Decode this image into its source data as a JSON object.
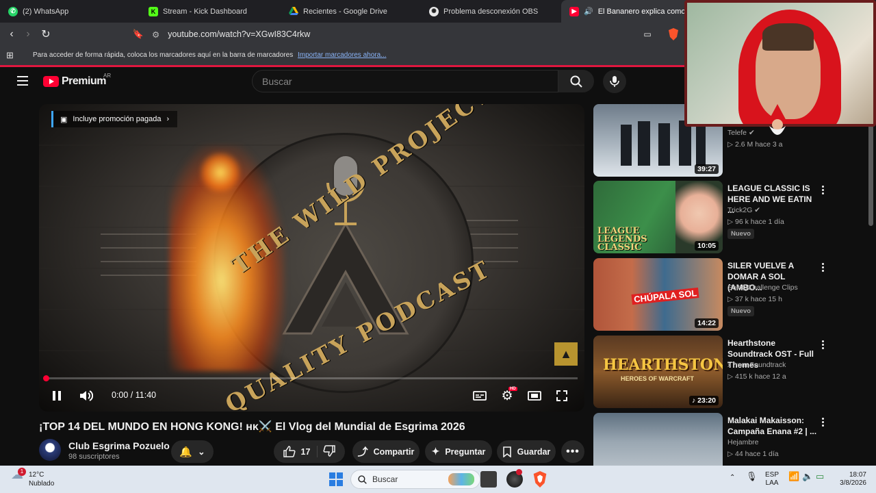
{
  "browser": {
    "tabs": [
      {
        "label": "(2) WhatsApp",
        "icon": "whatsapp-icon",
        "color": "#25d366"
      },
      {
        "label": "Stream - Kick Dashboard",
        "icon": "kick-icon",
        "color": "#53fc18"
      },
      {
        "label": "Recientes - Google Drive",
        "icon": "google-drive-icon",
        "color": "#fbbc04"
      },
      {
        "label": "Problema desconexión OBS",
        "icon": "chatgpt-icon",
        "color": "#cccccc"
      },
      {
        "label": "El Bananero explica como su",
        "icon": "youtube-icon",
        "color": "#ff0033"
      }
    ],
    "url": "youtube.com/watch?v=XGwI83C4rkw",
    "bookmarks_text": "Para acceder de forma rápida, coloca los marcadores aquí en la barra de marcadores",
    "bookmarks_link": "Importar marcadores ahora..."
  },
  "youtube": {
    "logo_text": "Premium",
    "region": "AR",
    "search_placeholder": "Buscar"
  },
  "player": {
    "promo_label": "Incluye promoción pagada",
    "time": "0:00 / 11:40",
    "progress": 0.0,
    "overlay_words": [
      "THE WILD PROJECT",
      "QUALITY PODCAST"
    ],
    "hd_badge": "HD"
  },
  "video": {
    "title": "¡TOP 14 DEL MUNDO EN HONG KONG! ʜᴋ⚔️ El Vlog del Mundial de Esgrima 2026",
    "channel": "Club Esgrima Pozuelo",
    "subscribers": "98 suscriptores",
    "likes": "17",
    "share_label": "Compartir",
    "ask_label": "Preguntar",
    "save_label": "Guardar"
  },
  "recommendations": [
    {
      "title": "",
      "channel": "Telefe",
      "verified": true,
      "views": "2.6 M",
      "age": "hace 3 a",
      "duration": "39:27",
      "new": false
    },
    {
      "title": "LEAGUE CLASSIC IS HERE AND WE EATIN ...",
      "channel": "Trick2G",
      "verified": true,
      "views": "96 k",
      "age": "hace 1 día",
      "duration": "10:05",
      "new": true
    },
    {
      "title": "SILER VUELVE A DOMAR A SOL (AMBO...",
      "channel": "SoloQChallenge Clips",
      "verified": false,
      "views": "37 k",
      "age": "hace 15 h",
      "duration": "14:22",
      "new": true
    },
    {
      "title": "Hearthstone Soundtrack OST - Full Themes",
      "channel": "xTrem Soundtrack",
      "verified": false,
      "views": "415 k",
      "age": "hace 12 a",
      "duration": "23:20",
      "new": false
    },
    {
      "title": "Malakai Makaisson: Campaña Enana #2 | ...",
      "channel": "Hejambre",
      "verified": false,
      "views": "44",
      "age": "hace 1 día",
      "duration": "",
      "new": false
    }
  ],
  "badge_new_label": "Nuevo",
  "thumb_texts": {
    "lol": "LEAGUE LEGENDS CLASSIC",
    "sol": "CHÚPALA SOL",
    "hs": "HEARTHSTONE",
    "hs_sub": "HEROES OF WARCRAFT"
  },
  "taskbar": {
    "temperature": "12°C",
    "weather": "Nublado",
    "weather_badge": "1",
    "search": "Buscar",
    "lang_top": "ESP",
    "lang_bottom": "LAA",
    "time": "18:07",
    "date": "3/8/2026"
  },
  "colors": {
    "accent": "#ff0033",
    "background": "#0f0f0f",
    "link": "#8ab4f8"
  }
}
